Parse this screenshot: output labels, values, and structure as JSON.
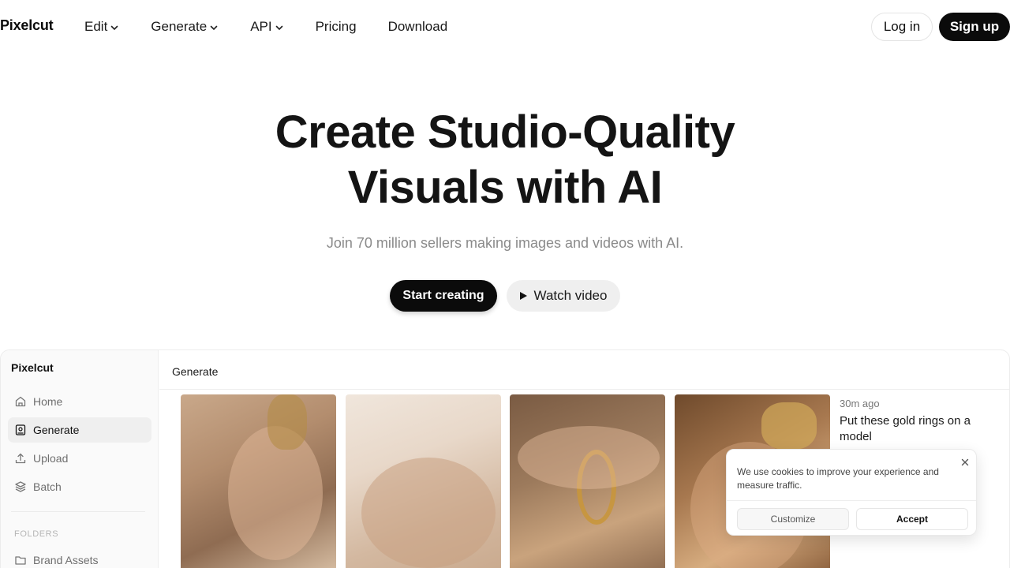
{
  "nav": {
    "logo": "Pixelcut",
    "items": [
      {
        "label": "Edit",
        "dropdown": true
      },
      {
        "label": "Generate",
        "dropdown": true
      },
      {
        "label": "API",
        "dropdown": true
      },
      {
        "label": "Pricing",
        "dropdown": false
      },
      {
        "label": "Download",
        "dropdown": false
      }
    ],
    "login_label": "Log in",
    "signup_label": "Sign up"
  },
  "hero": {
    "title_line1": "Create Studio-Quality",
    "title_line2": "Visuals with AI",
    "subtitle": "Join 70 million sellers making images and videos with AI.",
    "start_label": "Start creating",
    "watch_label": "Watch video"
  },
  "app": {
    "brand": "Pixelcut",
    "sidebar_items": [
      {
        "label": "Home",
        "icon": "home-icon"
      },
      {
        "label": "Generate",
        "icon": "generate-icon",
        "active": true
      },
      {
        "label": "Upload",
        "icon": "upload-icon"
      },
      {
        "label": "Batch",
        "icon": "layers-icon"
      }
    ],
    "folders_heading": "FOLDERS",
    "folders": [
      {
        "label": "Brand Assets",
        "icon": "folder-icon"
      }
    ],
    "main_title": "Generate",
    "generation": {
      "time": "30m ago",
      "prompt": "Put these gold rings on a model"
    }
  },
  "cookie": {
    "text": "We use cookies to improve your experience and measure traffic.",
    "customize_label": "Customize",
    "accept_label": "Accept"
  },
  "colors": {
    "primary": "#0b0b0b",
    "muted_text": "#8a8a8a",
    "surface": "#fafafa"
  }
}
